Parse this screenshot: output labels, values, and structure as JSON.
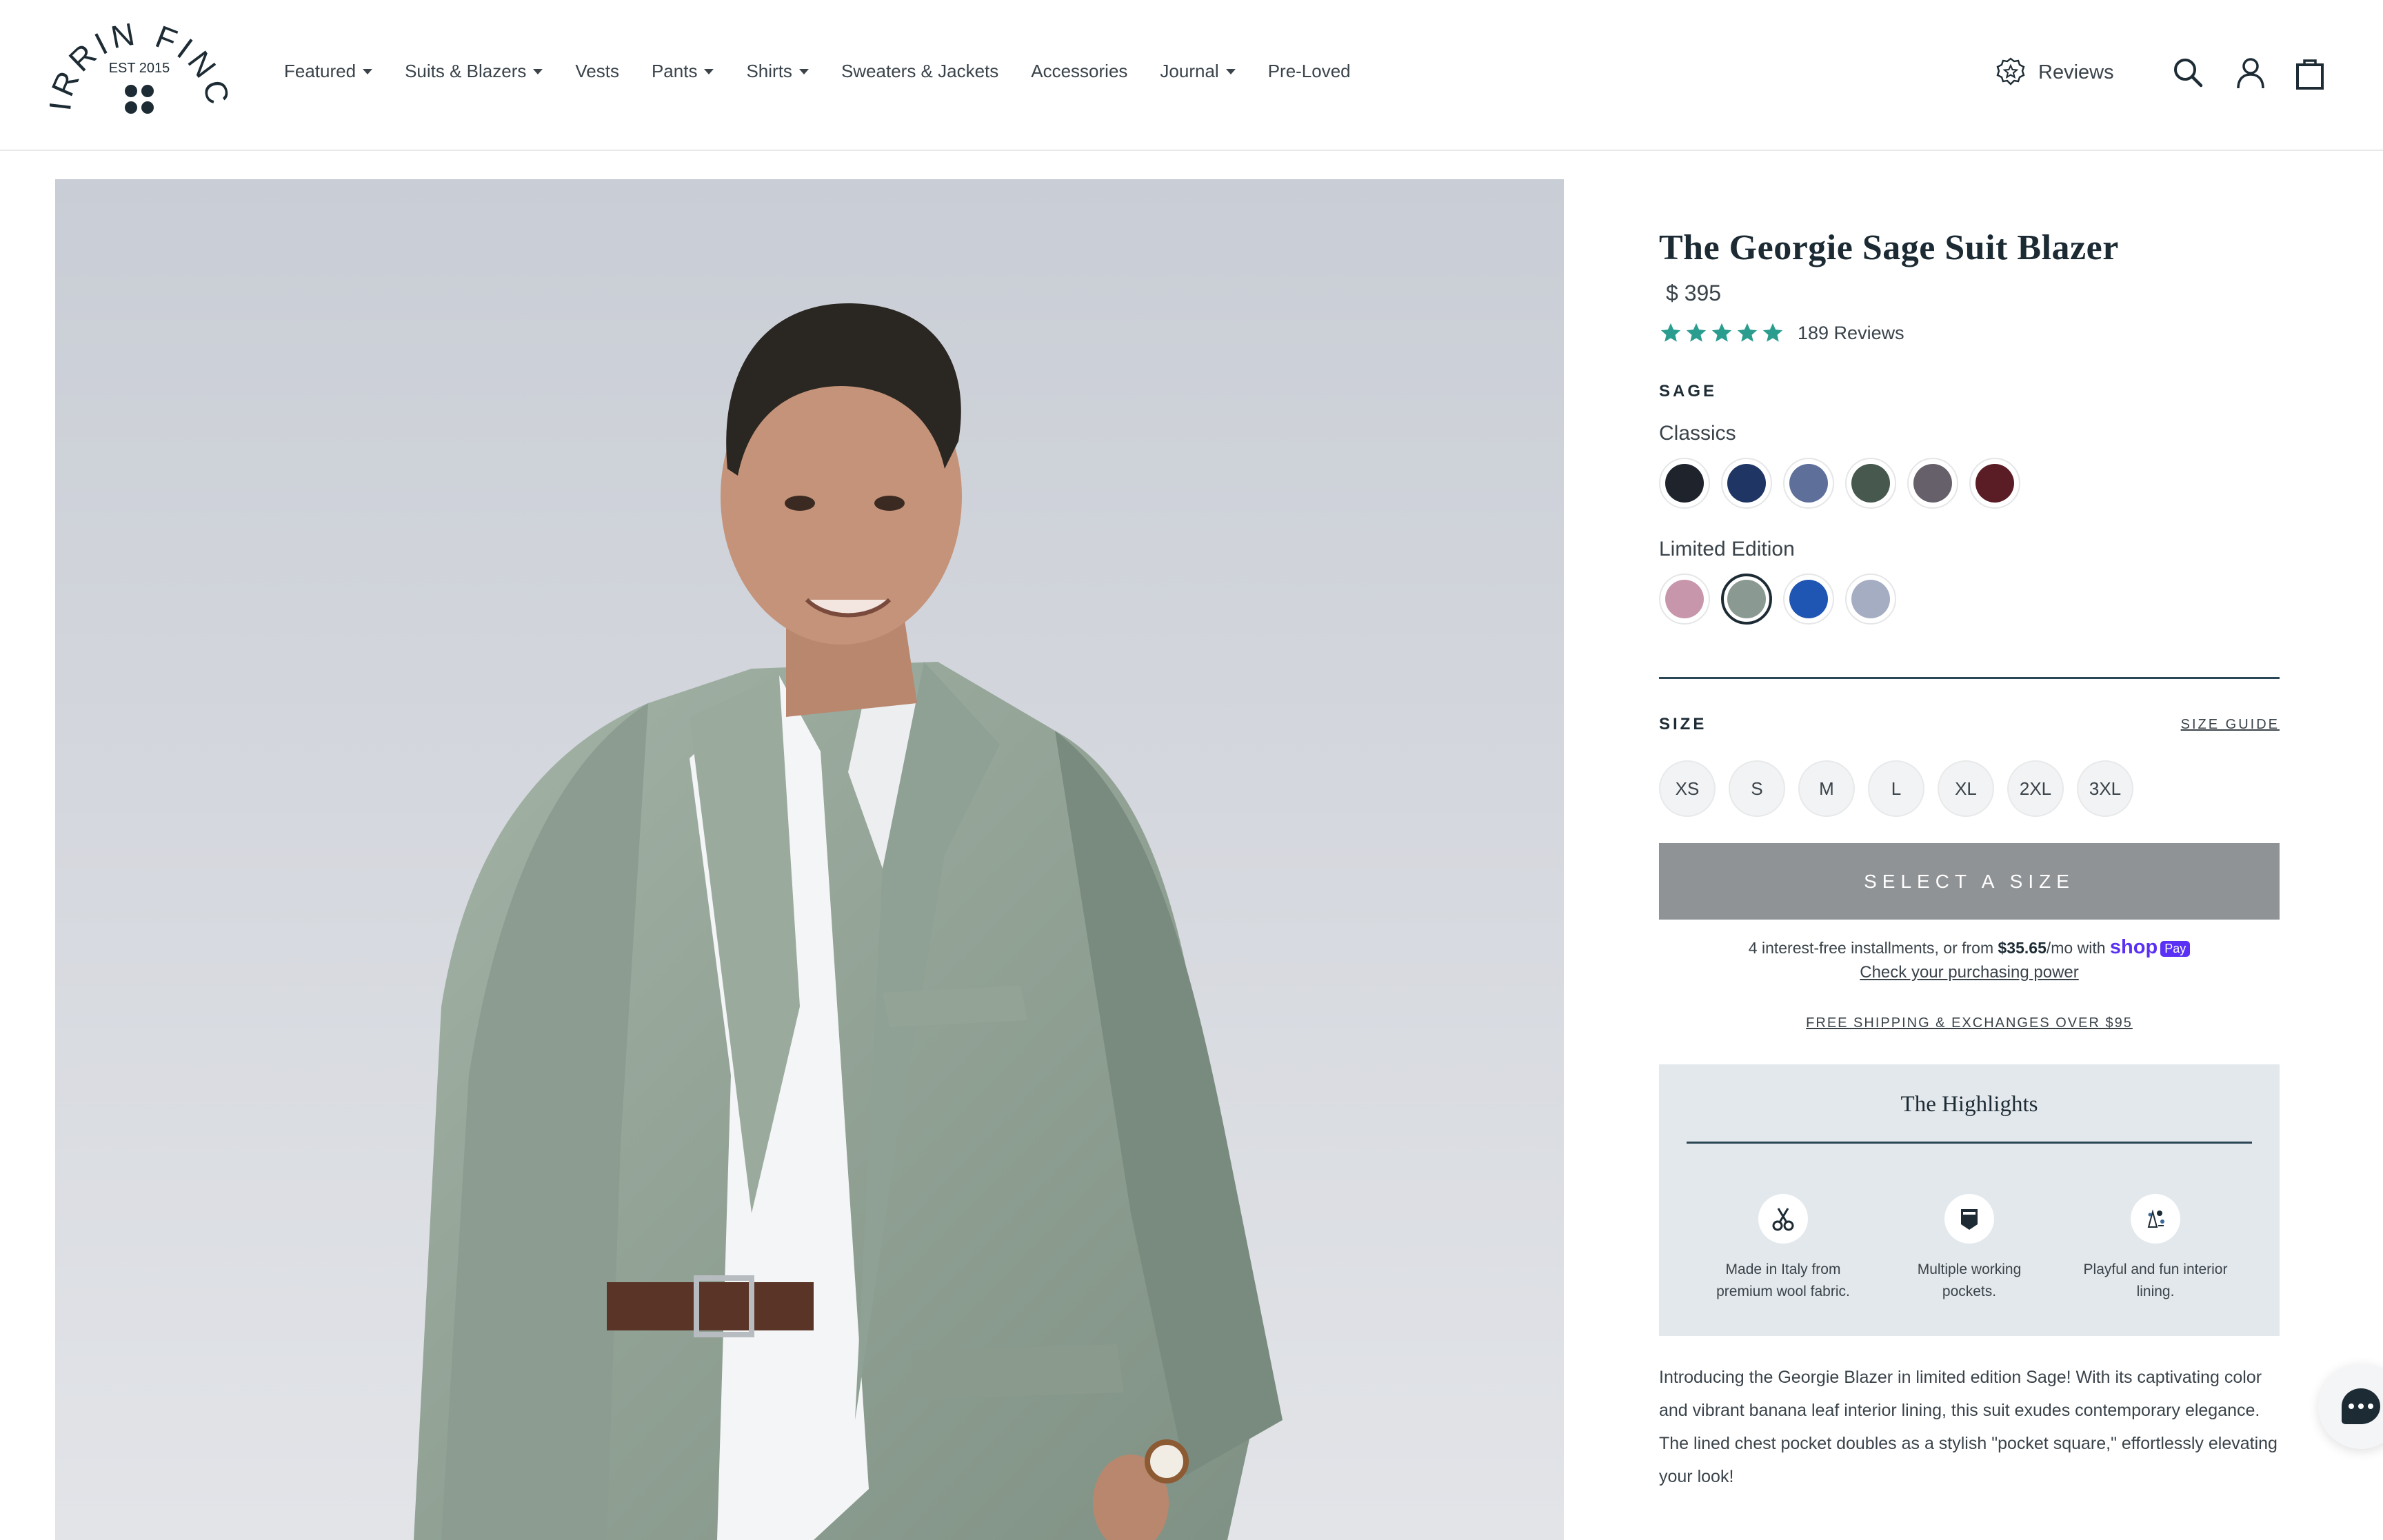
{
  "brand": {
    "name": "KIRRIN FINCH",
    "established": "EST 2015"
  },
  "nav": {
    "items": [
      {
        "label": "Featured",
        "dropdown": true
      },
      {
        "label": "Suits & Blazers",
        "dropdown": true
      },
      {
        "label": "Vests",
        "dropdown": false
      },
      {
        "label": "Pants",
        "dropdown": true
      },
      {
        "label": "Shirts",
        "dropdown": true
      },
      {
        "label": "Sweaters & Jackets",
        "dropdown": false
      },
      {
        "label": "Accessories",
        "dropdown": false
      },
      {
        "label": "Journal",
        "dropdown": true
      },
      {
        "label": "Pre-Loved",
        "dropdown": false
      }
    ],
    "reviews_label": "Reviews"
  },
  "product": {
    "title": "The Georgie Sage Suit Blazer",
    "price": "$ 395",
    "rating": 5,
    "review_count": "189 Reviews",
    "color_label": "SAGE",
    "color_groups": [
      {
        "label": "Classics",
        "colors": [
          "#1e232c",
          "#1f3564",
          "#5e6f9a",
          "#47594f",
          "#66606a",
          "#5a1d26"
        ]
      },
      {
        "label": "Limited Edition",
        "colors": [
          "#c896ab",
          "#8a9a92",
          "#1f55b3",
          "#a5adc2"
        ]
      }
    ],
    "selected_color": "Sage",
    "size_label": "SIZE",
    "size_guide_label": "SIZE GUIDE",
    "sizes": [
      "XS",
      "S",
      "M",
      "L",
      "XL",
      "2XL",
      "3XL"
    ],
    "cta_label": "SELECT A SIZE",
    "installments": {
      "prefix": "4 interest-free installments, or from ",
      "amount": "$35.65",
      "suffix": "/mo with ",
      "provider": "shop",
      "badge": "Pay",
      "link": "Check your purchasing power"
    },
    "shipping_label": "FREE SHIPPING & EXCHANGES OVER $95",
    "highlights": {
      "title": "The Highlights",
      "items": [
        {
          "icon": "scissors-icon",
          "text": "Made in Italy from premium wool fabric."
        },
        {
          "icon": "pocket-icon",
          "text": "Multiple working pockets."
        },
        {
          "icon": "lining-icon",
          "text": "Playful and fun interior lining."
        }
      ]
    },
    "description": "Introducing the Georgie Blazer in limited edition Sage! With its captivating color and vibrant banana leaf interior lining, this suit exudes contemporary elegance. The lined chest pocket doubles as a stylish \"pocket square,\" effortlessly elevating your look!"
  },
  "colors": {
    "brand_navy": "#1d2b34",
    "star_teal": "#2a9d8f",
    "button_gray": "#909396",
    "highlight_bg": "#e3e8ec",
    "shop_pay_purple": "#5a31f4"
  }
}
